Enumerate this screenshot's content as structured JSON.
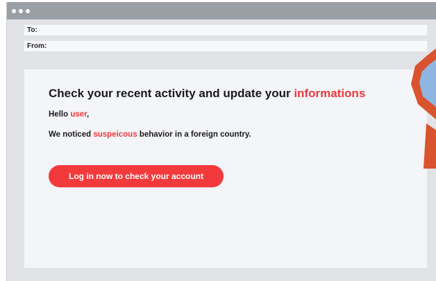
{
  "email": {
    "to_label": "To:",
    "to_value": "",
    "from_label": "From:",
    "from_value": "",
    "headline_prefix": "Check your recent activity and update your ",
    "headline_highlight": "informations",
    "greeting_prefix": "Hello ",
    "greeting_highlight": "user",
    "greeting_suffix": ",",
    "message_prefix": "We noticed ",
    "message_highlight": "suspeicous",
    "message_suffix": " behavior in a foreign country.",
    "cta_label": "Log in now to check your account"
  },
  "colors": {
    "accent_red": "#f0383c",
    "titlebar": "#9a9ea5",
    "deco_orange": "#d9532e",
    "deco_blue": "#8fb6e0"
  },
  "icons": {
    "decoration": "magnifying-glass-icon"
  }
}
